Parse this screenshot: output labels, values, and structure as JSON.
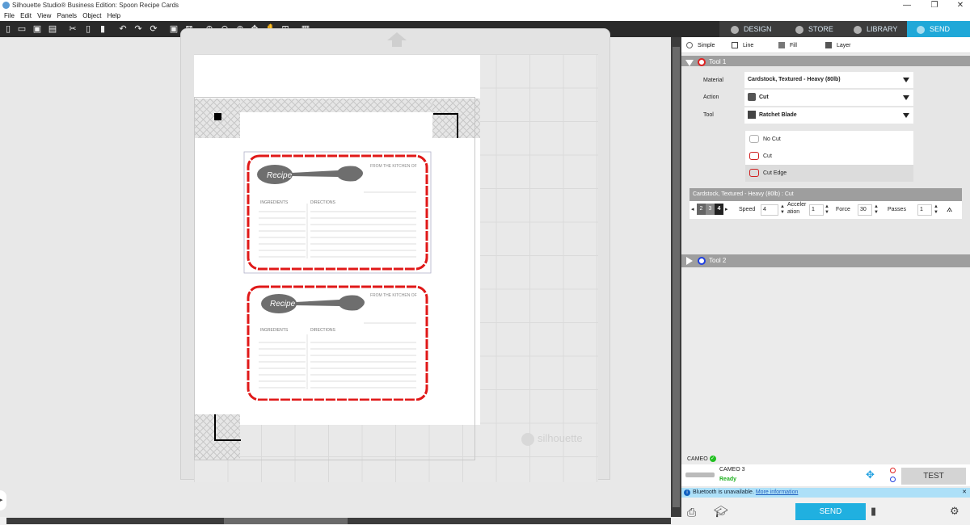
{
  "window": {
    "title": "Silhouette Studio® Business Edition: Spoon Recipe Cards",
    "minimize": "—",
    "restore": "❐",
    "close": "✕"
  },
  "menu": [
    "File",
    "Edit",
    "View",
    "Panels",
    "Object",
    "Help"
  ],
  "toolbar_icons": [
    "new-icon",
    "open-icon",
    "save-icon",
    "print-icon",
    "cut-icon",
    "copy-icon",
    "paste-icon",
    "undo-icon",
    "redo-icon",
    "refresh-icon",
    "group-icon",
    "ungroup-icon",
    "zoom-in-icon",
    "zoom-out-icon",
    "zoom-fit-icon",
    "move-icon",
    "pan-icon",
    "add-page-icon",
    "grid-icon"
  ],
  "tabs": [
    {
      "label": "DESIGN",
      "icon": "design-icon"
    },
    {
      "label": "STORE",
      "icon": "store-icon"
    },
    {
      "label": "LIBRARY",
      "icon": "library-icon"
    },
    {
      "label": "SEND",
      "icon": "send-icon",
      "active": true
    }
  ],
  "card": {
    "recipe": "Recipe",
    "from_kitchen": "FROM THE KITCHEN OF",
    "ingredients": "INGREDIENTS",
    "directions": "DIRECTIONS"
  },
  "watermark": "silhouette",
  "modes": [
    {
      "label": "Simple",
      "icon": "radio-icon"
    },
    {
      "label": "Line",
      "icon": "line-mode-icon"
    },
    {
      "label": "Fill",
      "icon": "fill-mode-icon"
    },
    {
      "label": "Layer",
      "icon": "layer-mode-icon"
    }
  ],
  "tool1": {
    "header": "Tool 1",
    "ring_color": "#e02020",
    "material_label": "Material",
    "material_value": "Cardstock, Textured - Heavy (80lb)",
    "action_label": "Action",
    "action_value": "Cut",
    "tool_label": "Tool",
    "tool_value": "Ratchet Blade",
    "cut_options": [
      "No Cut",
      "Cut",
      "Cut Edge"
    ],
    "summary": "Cardstock, Textured - Heavy (80lb) : Cut",
    "blade_numbers": [
      "2",
      "3",
      "4"
    ],
    "speed_label": "Speed",
    "speed_value": "4",
    "accel_label_1": "Acceler",
    "accel_label_2": "ation",
    "accel_value": "1",
    "force_label": "Force",
    "force_value": "30",
    "passes_label": "Passes",
    "passes_value": "1"
  },
  "tool2": {
    "header": "Tool 2",
    "ring_color": "#2040e0"
  },
  "device": {
    "header": "CAMEO",
    "name": "CAMEO 3",
    "status": "Ready",
    "test_label": "TEST"
  },
  "bluetooth": {
    "message": "Bluetooth is unavailable.",
    "link": "More information",
    "close": "✕"
  },
  "send_label": "SEND",
  "colors": {
    "accent": "#20a8d8",
    "cut_red": "#e01818",
    "spoon_gray": "#6e6e6e",
    "ready_green": "#20c020"
  }
}
